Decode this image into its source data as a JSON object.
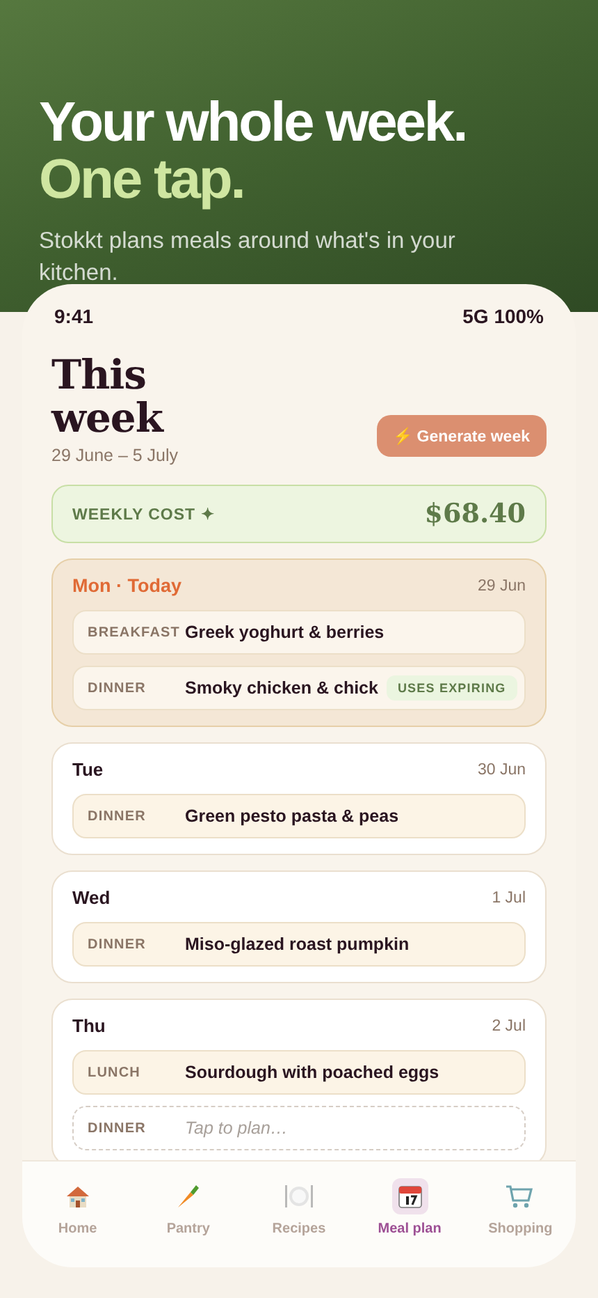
{
  "hero": {
    "title": "Your whole week.",
    "accent": "One tap.",
    "subtitle": "Stokkt plans meals around what's in your kitchen."
  },
  "status_bar": {
    "time": "9:41",
    "signal": "5G 100%"
  },
  "header": {
    "title": "This week",
    "dates": "29 June – 5 July",
    "button": "⚡ Generate week"
  },
  "weekly_cost": {
    "label": "WEEKLY COST ✦",
    "amount": "$68.40"
  },
  "days": [
    {
      "name": "Mon · Today",
      "date": "29 Jun",
      "today": true,
      "meals": [
        {
          "kind": "meal",
          "slot": "BREAKFAST",
          "name": "Greek yoghurt & berries"
        },
        {
          "kind": "meal",
          "slot": "DINNER",
          "name": "Smoky chicken & chick",
          "badge": "USES EXPIRING"
        }
      ]
    },
    {
      "name": "Tue",
      "date": "30 Jun",
      "today": false,
      "meals": [
        {
          "kind": "meal",
          "slot": "DINNER",
          "name": "Green pesto pasta & peas"
        }
      ]
    },
    {
      "name": "Wed",
      "date": "1 Jul",
      "today": false,
      "meals": [
        {
          "kind": "meal",
          "slot": "DINNER",
          "name": "Miso-glazed roast pumpkin"
        }
      ]
    },
    {
      "name": "Thu",
      "date": "2 Jul",
      "today": false,
      "meals": [
        {
          "kind": "meal",
          "slot": "LUNCH",
          "name": "Sourdough with poached eggs"
        },
        {
          "kind": "empty",
          "slot": "DINNER",
          "placeholder": "Tap to plan…"
        }
      ]
    }
  ],
  "nav": [
    {
      "label": "Home",
      "selected": false
    },
    {
      "label": "Pantry",
      "selected": false
    },
    {
      "label": "Recipes",
      "selected": false
    },
    {
      "label": "Meal plan",
      "selected": true
    },
    {
      "label": "Shopping",
      "selected": false
    }
  ]
}
